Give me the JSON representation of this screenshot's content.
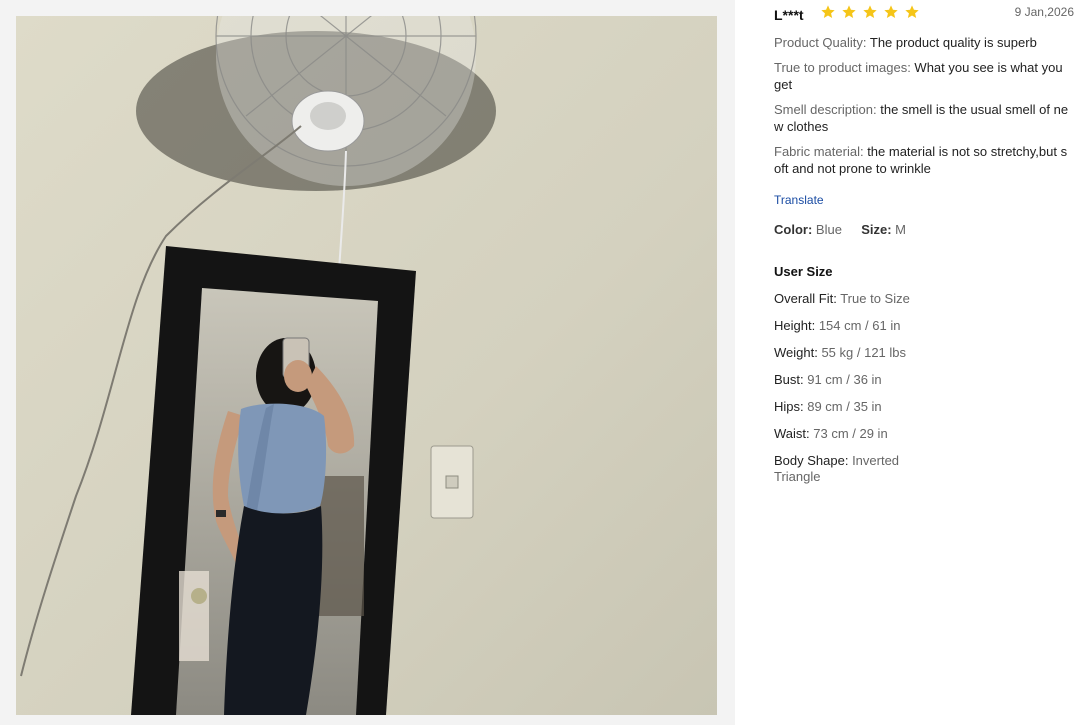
{
  "photo": {
    "icon": "review-photo"
  },
  "review": {
    "reviewer": "L***t",
    "rating": 5,
    "max_rating": 5,
    "star_color": "#f5c518",
    "date": "9 Jan,2026",
    "attributes": [
      {
        "key": "Product Quality:",
        "value": " The product quality is superb"
      },
      {
        "key": "True to product images:",
        "value": " What you see is what you get"
      },
      {
        "key": "Smell description:",
        "value": " the smell is the usual smell of new clothes"
      },
      {
        "key": "Fabric material:",
        "value": " the material is not so stretchy,but soft and not prone to wrinkle"
      }
    ],
    "translate_label": "Translate",
    "translate_color": "#1a4ca3",
    "color_key": "Color:",
    "color_value": "Blue",
    "size_key": "Size:",
    "size_value": "M"
  },
  "user_size": {
    "title": "User Size",
    "rows": [
      {
        "key": "Overall Fit:",
        "value": " True to Size"
      },
      {
        "key": "Height:",
        "value": " 154 cm / 61 in"
      },
      {
        "key": "Weight:",
        "value": " 55 kg / 121 lbs"
      },
      {
        "key": "Bust:",
        "value": " 91 cm / 36 in"
      },
      {
        "key": "Hips:",
        "value": " 89 cm / 35 in"
      },
      {
        "key": "Waist:",
        "value": " 73 cm / 29 in"
      },
      {
        "key": "Body Shape:",
        "value": " Inverted Triangle"
      }
    ]
  }
}
